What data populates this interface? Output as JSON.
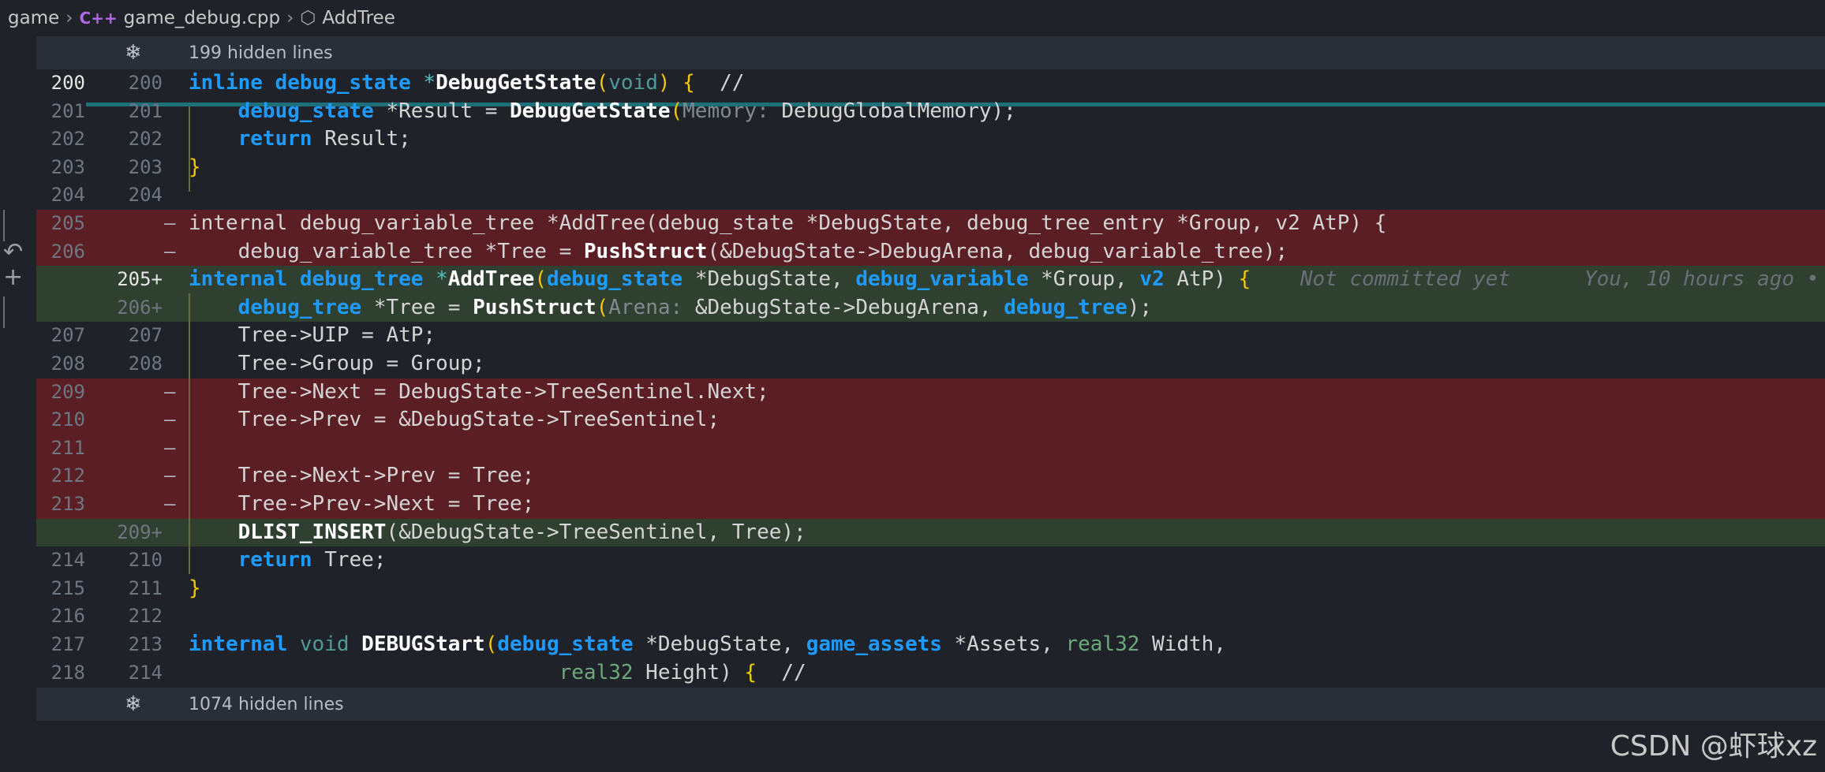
{
  "breadcrumb": {
    "folder": "game",
    "file_icon": "C++",
    "file": "game_debug.cpp",
    "symbol": "AddTree"
  },
  "hidden_top": "199 hidden lines",
  "hidden_bottom": "1074 hidden lines",
  "watermark": "CSDN @虾球xz",
  "blame": {
    "note": "Not committed yet",
    "author": "You, 10 hours ago •"
  },
  "lines": [
    {
      "old": "200",
      "new": "200",
      "marker": ""
    },
    {
      "old": "201",
      "new": "201",
      "marker": ""
    },
    {
      "old": "202",
      "new": "202",
      "marker": ""
    },
    {
      "old": "203",
      "new": "203",
      "marker": ""
    },
    {
      "old": "204",
      "new": "204",
      "marker": ""
    },
    {
      "old": "205",
      "new": "",
      "marker": "—"
    },
    {
      "old": "206",
      "new": "",
      "marker": "—"
    },
    {
      "old": "",
      "new": "205+",
      "marker": ""
    },
    {
      "old": "",
      "new": "206+",
      "marker": ""
    },
    {
      "old": "207",
      "new": "207",
      "marker": ""
    },
    {
      "old": "208",
      "new": "208",
      "marker": ""
    },
    {
      "old": "209",
      "new": "",
      "marker": "—"
    },
    {
      "old": "210",
      "new": "",
      "marker": "—"
    },
    {
      "old": "211",
      "new": "",
      "marker": "—"
    },
    {
      "old": "212",
      "new": "",
      "marker": "—"
    },
    {
      "old": "213",
      "new": "",
      "marker": "—"
    },
    {
      "old": "",
      "new": "209+",
      "marker": ""
    },
    {
      "old": "214",
      "new": "210",
      "marker": ""
    },
    {
      "old": "215",
      "new": "211",
      "marker": ""
    },
    {
      "old": "216",
      "new": "212",
      "marker": ""
    },
    {
      "old": "217",
      "new": "213",
      "marker": ""
    },
    {
      "old": "218",
      "new": "214",
      "marker": ""
    }
  ],
  "code": {
    "l0": {
      "a": "inline",
      "b": " ",
      "c": "debug_state",
      "d": " *",
      "e": "DebugGetState",
      "f": "(",
      "g": "void",
      "h": ") ",
      "i": "{",
      "j": "  //"
    },
    "l1": {
      "a": "    ",
      "b": "debug_state",
      "c": " *Result = ",
      "d": "DebugGetState",
      "e": "(",
      "f": "Memory: ",
      "g": "DebugGlobalMemory);"
    },
    "l2": {
      "a": "    ",
      "b": "return",
      "c": " Result;"
    },
    "l3": {
      "a": "}"
    },
    "l5": {
      "a": "internal debug_variable_tree *AddTree(debug_state *DebugState, debug_tree_entry *Group, v2 AtP) {"
    },
    "l6": {
      "a": "    debug_variable_tree *Tree = ",
      "b": "PushStruct",
      "c": "(&DebugState->DebugArena, debug_variable_tree);"
    },
    "l7": {
      "a": "internal",
      "b": " ",
      "c": "debug_tree",
      "d": " *",
      "e": "AddTree",
      "f": "(",
      "g": "debug_state",
      "h": " *DebugState, ",
      "i": "debug_variable",
      "j": " *Group, ",
      "k": "v2",
      "l": " AtP) ",
      "m": "{"
    },
    "l8": {
      "a": "    ",
      "b": "debug_tree",
      "c": " *Tree = ",
      "d": "PushStruct",
      "e": "(",
      "f": "Arena: ",
      "g": "&DebugState->DebugArena, ",
      "h": "debug_tree",
      "i": ");"
    },
    "l9": {
      "a": "    Tree->UIP = AtP;"
    },
    "l10": {
      "a": "    Tree->Group = Group;"
    },
    "l11": {
      "a": "    Tree->Next = DebugState->TreeSentinel.Next;"
    },
    "l12": {
      "a": "    Tree->Prev = &DebugState->TreeSentinel;"
    },
    "l14": {
      "a": "    Tree->Next->Prev = Tree;"
    },
    "l15": {
      "a": "    Tree->Prev->Next = Tree;"
    },
    "l16": {
      "a": "    ",
      "b": "DLIST_INSERT",
      "c": "(&DebugState->TreeSentinel, Tree);"
    },
    "l17": {
      "a": "    ",
      "b": "return",
      "c": " Tree;"
    },
    "l18": {
      "a": "}"
    },
    "l20": {
      "a": "internal",
      "b": " ",
      "c": "void",
      "d": " ",
      "e": "DEBUGStart",
      "f": "(",
      "g": "debug_state",
      "h": " *DebugState, ",
      "i": "game_assets",
      "j": " *Assets, ",
      "k": "real32",
      "l": " Width,"
    },
    "l21": {
      "a": "                              ",
      "b": "real32",
      "c": " Height) ",
      "d": "{",
      "e": "  //"
    }
  }
}
